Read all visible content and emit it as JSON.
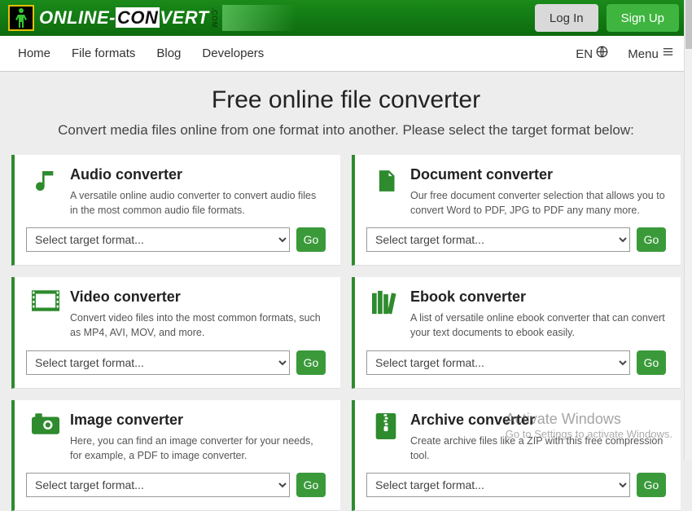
{
  "brand": {
    "part1": "ONLINE-",
    "part2": "CON",
    "part3": "VERT",
    "dotcom": ".COM"
  },
  "auth": {
    "login": "Log In",
    "signup": "Sign Up"
  },
  "nav": {
    "items": [
      "Home",
      "File formats",
      "Blog",
      "Developers"
    ],
    "lang": "EN",
    "menu": "Menu"
  },
  "hero": {
    "title": "Free online file converter",
    "subtitle": "Convert media files online from one format into another. Please select the target format below:"
  },
  "select_placeholder": "Select target format...",
  "go_label": "Go",
  "cards": [
    {
      "icon": "music",
      "title": "Audio converter",
      "desc": "A versatile online audio converter to convert audio files in the most common audio file formats."
    },
    {
      "icon": "doc",
      "title": "Document converter",
      "desc": "Our free document converter selection that allows you to convert Word to PDF, JPG to PDF any many more."
    },
    {
      "icon": "film",
      "title": "Video converter",
      "desc": "Convert video files into the most common formats, such as MP4, AVI, MOV, and more."
    },
    {
      "icon": "books",
      "title": "Ebook converter",
      "desc": "A list of versatile online ebook converter that can convert your text documents to ebook easily."
    },
    {
      "icon": "camera",
      "title": "Image converter",
      "desc": "Here, you can find an image converter for your needs, for example, a PDF to image converter."
    },
    {
      "icon": "zip",
      "title": "Archive converter",
      "desc": "Create archive files like a ZIP with this free compression tool."
    }
  ],
  "watermark": {
    "title": "Activate Windows",
    "sub": "Go to Settings to activate Windows."
  }
}
